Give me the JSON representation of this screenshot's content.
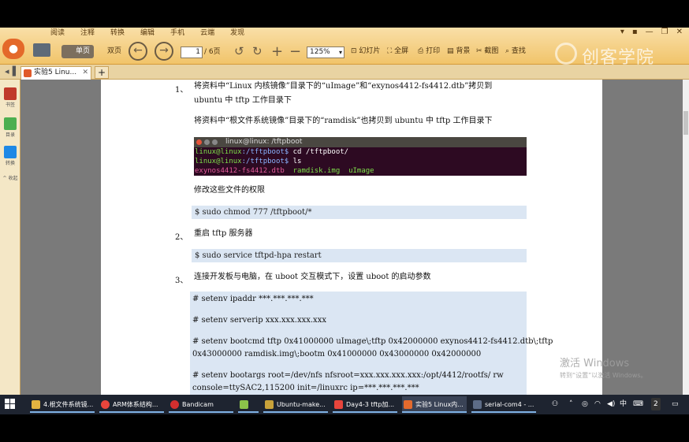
{
  "menu": [
    "阅读",
    "注释",
    "转换",
    "编辑",
    "手机",
    "云端",
    "发现"
  ],
  "window_controls": [
    "▾",
    "▪",
    "—",
    "❐",
    "✕"
  ],
  "toolbar": {
    "single_page": "单页",
    "double_page": "双页",
    "page_current": "1",
    "page_total": "/ 6页",
    "zoom": "125%",
    "slideshow": "幻灯片",
    "fullscreen": "全屏",
    "print": "打印",
    "background": "背景",
    "screenshot": "截图",
    "find": "查找"
  },
  "brand": "创客学院",
  "tab": {
    "label": "实验5 Linu...",
    "plus": "+"
  },
  "sidebar": [
    {
      "label": "书签",
      "color": "#c0392b"
    },
    {
      "label": "目录",
      "color": "#4caf50"
    },
    {
      "label": "转换",
      "color": "#1e88e5"
    },
    {
      "label": "^ 收起",
      "color": ""
    }
  ],
  "document": {
    "step1_num": "1、",
    "step1_line1": "将资料中“Linux 内核镜像”目录下的“uImage”和“exynos4412-fs4412.dtb”拷贝到",
    "step1_line2": "ubuntu 中 tftp 工作目录下",
    "step1_line3": "将资料中“根文件系统镜像”目录下的“ramdisk”也拷贝到 ubuntu 中 tftp 工作目录下",
    "terminal": {
      "title": "linux@linux: /tftpboot",
      "prompt1_user": "linux@linux",
      "prompt1_path": ":/tftpboot$",
      "cmd1": " cd /tftpboot/",
      "prompt2_user": "linux@linux",
      "prompt2_path": ":/tftpboot$",
      "cmd2": " ls",
      "out_dtb": "exynos4412-fs4412.dtb",
      "out_ramdisk": "ramdisk.img",
      "out_uimage": "uImage"
    },
    "chmod_note": "修改这些文件的权限",
    "chmod_cmd": "$ sudo    chmod    777    /tftpboot/*",
    "step2_num": "2、",
    "step2_text": "重启 tftp 服务器",
    "restart_cmd": "$ sudo    service    tftpd-hpa    restart",
    "step3_num": "3、",
    "step3_text": "连接开发板与电脑，在 uboot 交互模式下，设置 uboot 的启动参数",
    "uboot": [
      "# setenv ipaddr ***.***.***.***",
      "# setenv serverip xxx.xxx.xxx.xxx",
      "# setenv bootcmd tftp 0x41000000 uImage\\;tftp 0x42000000 exynos4412-fs4412.dtb\\;tftp",
      "0x43000000 ramdisk.img\\;bootm 0x41000000 0x43000000 0x42000000",
      "# setenv bootargs root=/dev/nfs nfsroot=xxx.xxx.xxx.xxx:/opt/4412/rootfs/ rw",
      "console=ttySAC2,115200 init=/linuxrc ip=***.***.***.***"
    ]
  },
  "watermark": {
    "line1": "激活 Windows",
    "line2": "转到“设置”以激活 Windows。"
  },
  "taskbar": {
    "items": [
      {
        "label": "4.根文件系统镜...",
        "color": "#e3b341"
      },
      {
        "label": "ARM体系结构...",
        "color": "#e8453c"
      },
      {
        "label": "Bandicam",
        "color": "#d32f2f"
      },
      {
        "label": "",
        "color": "#8bc34a"
      },
      {
        "label": "Ubuntu-make...",
        "color": "#c8a23a"
      },
      {
        "label": "Day4-3 tftp加...",
        "color": "#e8453c"
      },
      {
        "label": "实验5 Linux内...",
        "color": "#e36a2d"
      },
      {
        "label": "serial-com4 - ...",
        "color": "#5d6c86"
      }
    ],
    "tray_ime": "中",
    "tray_badge": "2"
  }
}
